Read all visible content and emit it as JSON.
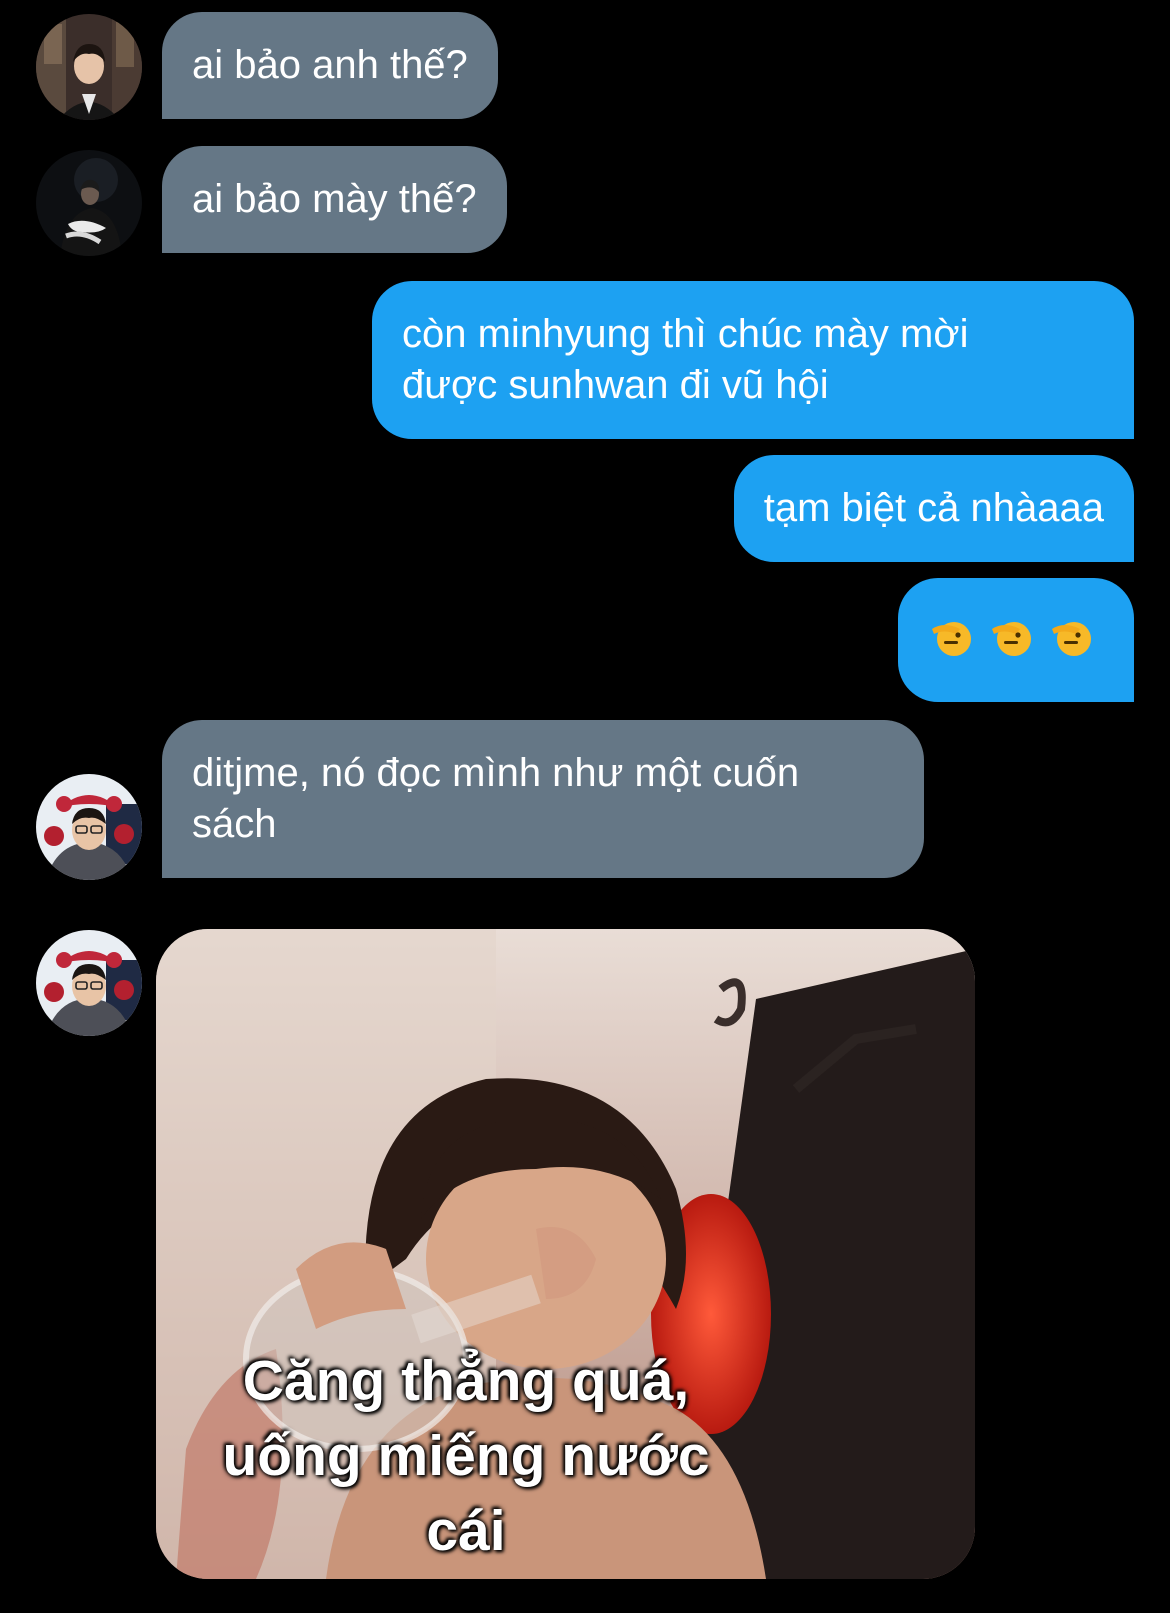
{
  "messages": [
    {
      "id": "m1",
      "direction": "incoming",
      "text": "ai bảo anh thế?"
    },
    {
      "id": "m2",
      "direction": "incoming",
      "text": "ai bảo mày thế?"
    },
    {
      "id": "m3",
      "direction": "outgoing",
      "line1": "còn minhyung thì chúc mày mời",
      "line2": "được sunhwan đi vũ hội"
    },
    {
      "id": "m4",
      "direction": "outgoing",
      "text": "tạm biệt cả nhàaaa"
    },
    {
      "id": "m5",
      "direction": "outgoing",
      "emoji": "saluting-face",
      "emoji_count": 3
    },
    {
      "id": "m6",
      "direction": "incoming",
      "line1": "ditjme, nó đọc mình như một cuốn",
      "line2": "sách"
    },
    {
      "id": "m7",
      "direction": "incoming",
      "media": "meme-image",
      "caption": "Căng thẳng quá,\nuống miếng nước\ncái"
    }
  ],
  "colors": {
    "background": "#000000",
    "incoming_bubble": "#657786",
    "outgoing_bubble": "#1da1f2",
    "text": "#ffffff"
  }
}
